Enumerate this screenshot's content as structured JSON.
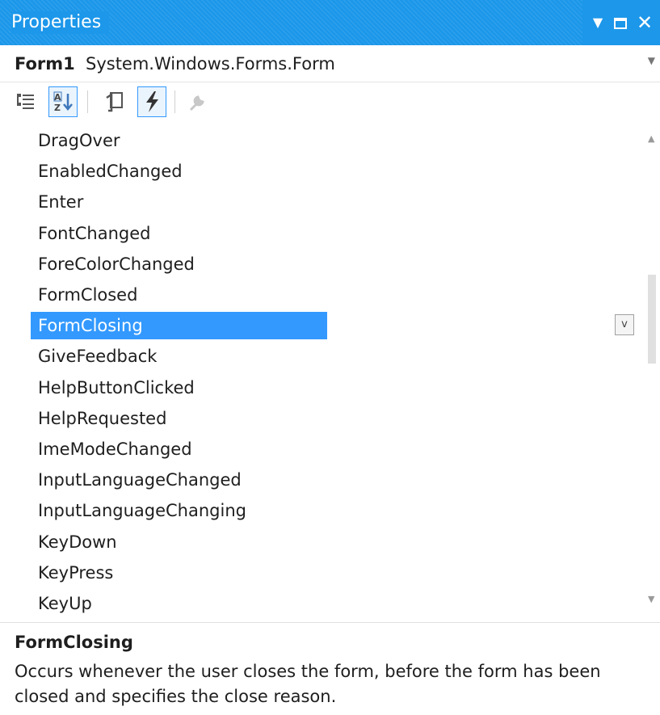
{
  "window": {
    "title": "Properties",
    "dropdown_glyph": "▼",
    "close_glyph": "✕"
  },
  "object_selector": {
    "name": "Form1",
    "type": "System.Windows.Forms.Form"
  },
  "toolbar": {
    "buttons": [
      {
        "icon": "categorized-icon",
        "checked": false
      },
      {
        "icon": "alphabetical-icon",
        "checked": true
      },
      {
        "icon": "properties-icon",
        "checked": false
      },
      {
        "icon": "events-icon",
        "checked": true
      },
      {
        "icon": "property-pages-icon",
        "enabled": false
      }
    ]
  },
  "events": [
    {
      "label": "DragOver"
    },
    {
      "label": "EnabledChanged"
    },
    {
      "label": "Enter"
    },
    {
      "label": "FontChanged"
    },
    {
      "label": "ForeColorChanged"
    },
    {
      "label": "FormClosed"
    },
    {
      "label": "FormClosing",
      "selected": true
    },
    {
      "label": "GiveFeedback"
    },
    {
      "label": "HelpButtonClicked"
    },
    {
      "label": "HelpRequested"
    },
    {
      "label": "ImeModeChanged"
    },
    {
      "label": "InputLanguageChanged"
    },
    {
      "label": "InputLanguageChanging"
    },
    {
      "label": "KeyDown"
    },
    {
      "label": "KeyPress"
    },
    {
      "label": "KeyUp"
    }
  ],
  "value_dropdown_glyph": "v",
  "description": {
    "title": "FormClosing",
    "text": "Occurs whenever the user closes the form, before the form has been closed and specifies the close reason."
  },
  "colors": {
    "titlebar": "#1c97ea",
    "selection": "#3399ff"
  }
}
